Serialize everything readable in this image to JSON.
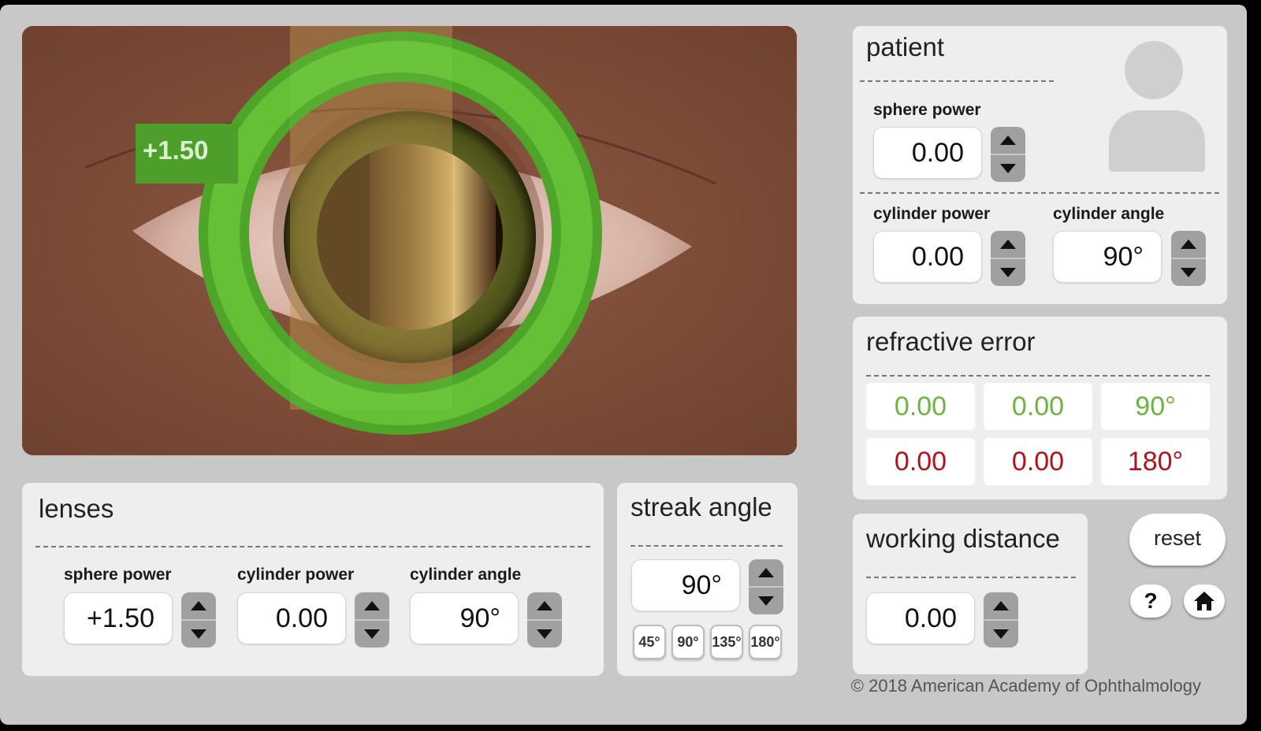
{
  "eye_view": {
    "lens_badge": "+1.50"
  },
  "patient": {
    "title": "patient",
    "sphere_power": {
      "label": "sphere power",
      "value": "0.00"
    },
    "cylinder_power": {
      "label": "cylinder power",
      "value": "0.00"
    },
    "cylinder_angle": {
      "label": "cylinder angle",
      "value": "90°"
    }
  },
  "refractive_error": {
    "title": "refractive error",
    "rows": [
      [
        "0.00",
        "0.00",
        "90°"
      ],
      [
        "0.00",
        "0.00",
        "180°"
      ]
    ],
    "row_colors": [
      "#6db33f",
      "#b3121b"
    ]
  },
  "lenses": {
    "title": "lenses",
    "sphere_power": {
      "label": "sphere power",
      "value": "+1.50"
    },
    "cylinder_power": {
      "label": "cylinder power",
      "value": "0.00"
    },
    "cylinder_angle": {
      "label": "cylinder angle",
      "value": "90°"
    }
  },
  "streak_angle": {
    "title": "streak angle",
    "value": "90°",
    "presets": [
      "45°",
      "90°",
      "135°",
      "180°"
    ]
  },
  "working_distance": {
    "title": "working distance",
    "value": "0.00"
  },
  "buttons": {
    "reset": "reset",
    "help": "?",
    "home_icon": "home-icon"
  },
  "footer": {
    "copyright": "© 2018 American Academy of Ophthalmology"
  }
}
